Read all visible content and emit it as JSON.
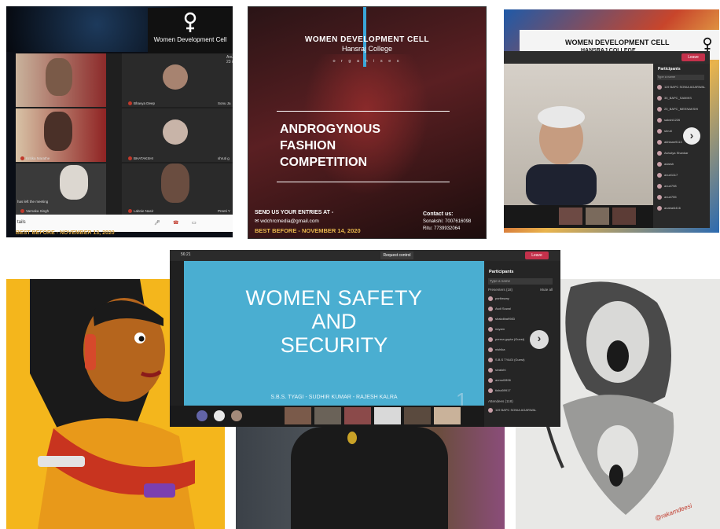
{
  "tile1": {
    "logo_text": "Women Development Cell",
    "participants": [
      {
        "name": "Bhavya Deep"
      },
      {
        "name": "Sonu Ja"
      },
      {
        "name": "Kritika Marathe"
      },
      {
        "name": "BHATAKSHI"
      },
      {
        "name": "shruti g"
      },
      {
        "name": "Varnaka Singh"
      },
      {
        "name": "Labnie Nasir"
      },
      {
        "name": "Preeti Y"
      }
    ],
    "side_label": "Anuj Rana and 23 m",
    "left_meeting_msg": "has left the meeting",
    "details_label": "tails",
    "best_before": "BEST BEFORE - NOVEMBER 13, 2020"
  },
  "poster": {
    "org_line1": "WOMEN DEVELOPMENT CELL",
    "org_line2": "Hansraj College",
    "organises": "o r g a n i s e s",
    "title_lines": [
      "ANDROGYNOUS",
      "FASHION",
      "COMPETITION"
    ],
    "send_entries": "SEND US YOUR ENTRIES AT -",
    "email": "wdchrcmedia@gmail.com",
    "best_before": "BEST BEFORE - NOVEMBER 14, 2020",
    "contact_label": "Contact us:",
    "phone1": "Sonakshi: 7007616098",
    "phone2": "Ritu: 7739932064"
  },
  "tile3": {
    "banner_line1": "WOMEN DEVELOPMENT CELL",
    "banner_line2": "HANSRAJ COLLEGE",
    "leave_label": "Leave",
    "participants_title": "Participants",
    "search_placeholder": "Type a name",
    "participants": [
      {
        "name": "119 BAPC SONIA AGARWAL"
      },
      {
        "name": "35_BAPC_SAMIKS"
      },
      {
        "name": "25_BAPC_MEENAKSHI"
      },
      {
        "name": "sakshi1226"
      },
      {
        "name": "shruti"
      },
      {
        "name": "akhlaan9113"
      },
      {
        "name": "Ashutya Shankar"
      },
      {
        "name": "adarsh"
      },
      {
        "name": "anuri1117"
      },
      {
        "name": "anuri798"
      },
      {
        "name": "anuri755"
      },
      {
        "name": "anahal4416"
      }
    ],
    "next_glyph": "›"
  },
  "slide": {
    "time": "56:21",
    "request_control": "Request control",
    "leave_label": "Leave",
    "title_lines": [
      "WOMEN SAFETY",
      "AND",
      "SECURITY"
    ],
    "authors": "S.B.S. TYAGI - SUDHIR KUMAR - RAJESH KALRA",
    "slide_number": "1",
    "participants_title": "Participants",
    "search_placeholder": "Type a name",
    "presenters_label": "Presenters (18)",
    "mute_all": "Mute all",
    "participants": [
      {
        "name": "pariksway"
      },
      {
        "name": "Asdi Suwal"
      },
      {
        "name": "shakdiba9983"
      },
      {
        "name": "nayam"
      },
      {
        "name": "prerna gupta (Guest)"
      },
      {
        "name": "nishika"
      },
      {
        "name": "S.B.S TYAGI (Guest)"
      },
      {
        "name": "sivalohi"
      },
      {
        "name": "anmol2896"
      },
      {
        "name": "tisha59917"
      }
    ],
    "attendees_label": "Attendees (118)",
    "attendee": "119 BAPC SONIA AGARWAL",
    "next_glyph": "›"
  },
  "sketch": {
    "signature": "@rakamdeesi"
  },
  "colors": {
    "teams_leave": "#c4314b",
    "slide_blue": "#4aaed1",
    "poster_gold": "#e9b84d",
    "art_yellow": "#f4b61c"
  }
}
